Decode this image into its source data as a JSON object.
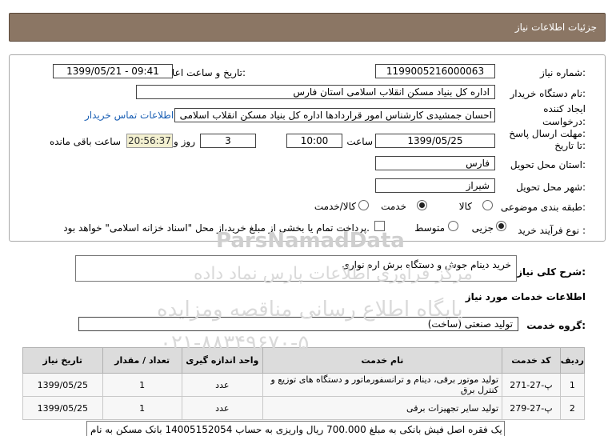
{
  "header": {
    "title": "جزئیات اطلاعات نیاز"
  },
  "form": {
    "need_number_label": "شماره نیاز:",
    "need_number": "1199005216000063",
    "announce_label": "تاریخ و ساعت اعلان عمومی:",
    "announce_value": "1399/05/21 - 09:41",
    "buyer_org_label": "نام دستگاه خریدار:",
    "buyer_org": "اداره کل بنیاد مسکن انقلاب اسلامی استان فارس",
    "creator_label_1": "ایجاد کننده",
    "creator_label_2": "درخواست:",
    "creator": "احسان جمشیدی کارشناس امور قراردادها اداره کل بنیاد مسکن انقلاب اسلامی",
    "contact_link": "اطلاعات تماس خریدار",
    "deadline_label_1": "مهلت ارسال پاسخ:",
    "deadline_label_2": "تا تاریخ:",
    "deadline_date": "1399/05/25",
    "time_label": "ساعت",
    "deadline_time": "10:00",
    "days_value": "3",
    "days_label": "روز و",
    "remaining_time": "20:56:37",
    "remaining_label": "ساعت باقی مانده",
    "province_label": "استان محل تحویل:",
    "province": "فارس",
    "city_label": "شهر محل تحویل:",
    "city": "شیراز",
    "category_label": "طبقه بندی موضوعی:",
    "category_options": [
      "کالا",
      "خدمت",
      "کالا/خدمت"
    ],
    "category_selected": "خدمت",
    "process_label": "نوع فرآیند خرید :",
    "process_options": [
      "جزیی",
      "متوسط"
    ],
    "process_selected": "جزیی",
    "payment_note": "پرداخت تمام یا بخشی از مبلغ خرید،از محل \"اسناد خزانه اسلامی\" خواهد بود."
  },
  "description": {
    "label": "شرح کلی نیاز:",
    "value": "خرید دینام جوش و دستگاه برش اره نواری"
  },
  "services": {
    "section_title": "اطلاعات خدمات مورد نیاز",
    "group_label": "گروه خدمت:",
    "group_value": "تولید صنعتی (ساخت)",
    "columns": [
      "ردیف",
      "کد خدمت",
      "نام خدمت",
      "واحد اندازه گیری",
      "تعداد / مقدار",
      "تاریخ نیاز"
    ],
    "rows": [
      {
        "row": "1",
        "code": "پ-27-271",
        "name": "تولید موتور برقی، دینام و ترانسفورماتور و دستگاه های توزیع و کنترل برق",
        "unit": "عدد",
        "qty": "1",
        "date": "1399/05/25"
      },
      {
        "row": "2",
        "code": "پ-27-279",
        "name": "تولید سایر تجهیزات برقی",
        "unit": "عدد",
        "qty": "1",
        "date": "1399/05/25"
      }
    ]
  },
  "notes": {
    "text": "یک فقره اصل فیش بانکی به مبلغ 700.000 ریال واریزی به حساب 14005152054 بانک مسکن به نام"
  },
  "watermark": {
    "line1": "ParsNamadData",
    "line2": "مرکز فراوری اطلاعات پارس نماد داده",
    "line3": "پایگاه اطلاع رسانی مناقصه ومزایده",
    "line4": "۰۲۱-۸۸۳۴۹۶۷۰-۵"
  }
}
